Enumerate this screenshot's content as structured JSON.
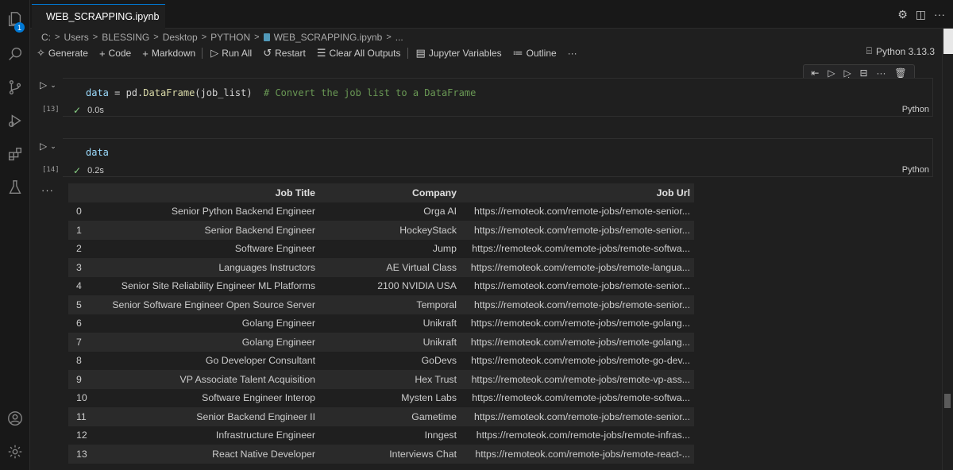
{
  "tab": {
    "title": "WEB_SCRAPPING.ipynb"
  },
  "activity": {
    "badge_count": "1"
  },
  "breadcrumb": {
    "items": [
      "C:",
      "Users",
      "BLESSING",
      "Desktop",
      "PYTHON",
      "WEB_SCRAPPING.ipynb",
      "..."
    ]
  },
  "toolbar": {
    "generate": "Generate",
    "code": "Code",
    "markdown": "Markdown",
    "run_all": "Run All",
    "restart": "Restart",
    "clear_outputs": "Clear All Outputs",
    "jupyter_variables": "Jupyter Variables",
    "outline": "Outline",
    "more": "···"
  },
  "kernel": {
    "label": "Python 3.13.3"
  },
  "cells": [
    {
      "exec": "[13]",
      "code_var": "data",
      "code_op": " = pd.",
      "code_fn": "DataFrame",
      "code_args": "(job_list)",
      "code_comment": "  # Convert the job list to a DataFrame",
      "time": "0.0s",
      "lang": "Python"
    },
    {
      "exec": "[14]",
      "code_var": "data",
      "time": "0.2s",
      "lang": "Python"
    }
  ],
  "output": {
    "more": "···",
    "columns": [
      "",
      "Job Title",
      "Company",
      "Job Url"
    ],
    "rows": [
      [
        "0",
        "Senior Python Backend Engineer",
        "Orga AI",
        "https://remoteok.com/remote-jobs/remote-senior..."
      ],
      [
        "1",
        "Senior Backend Engineer",
        "HockeyStack",
        "https://remoteok.com/remote-jobs/remote-senior..."
      ],
      [
        "2",
        "Software Engineer",
        "Jump",
        "https://remoteok.com/remote-jobs/remote-softwa..."
      ],
      [
        "3",
        "Languages Instructors",
        "AE Virtual Class",
        "https://remoteok.com/remote-jobs/remote-langua..."
      ],
      [
        "4",
        "Senior Site Reliability Engineer ML Platforms",
        "2100 NVIDIA USA",
        "https://remoteok.com/remote-jobs/remote-senior..."
      ],
      [
        "5",
        "Senior Software Engineer Open Source Server",
        "Temporal",
        "https://remoteok.com/remote-jobs/remote-senior..."
      ],
      [
        "6",
        "Golang Engineer",
        "Unikraft",
        "https://remoteok.com/remote-jobs/remote-golang..."
      ],
      [
        "7",
        "Golang Engineer",
        "Unikraft",
        "https://remoteok.com/remote-jobs/remote-golang..."
      ],
      [
        "8",
        "Go Developer Consultant",
        "GoDevs",
        "https://remoteok.com/remote-jobs/remote-go-dev..."
      ],
      [
        "9",
        "VP Associate Talent Acquisition",
        "Hex Trust",
        "https://remoteok.com/remote-jobs/remote-vp-ass..."
      ],
      [
        "10",
        "Software Engineer Interop",
        "Mysten Labs",
        "https://remoteok.com/remote-jobs/remote-softwa..."
      ],
      [
        "11",
        "Senior Backend Engineer II",
        "Gametime",
        "https://remoteok.com/remote-jobs/remote-senior..."
      ],
      [
        "12",
        "Infrastructure Engineer",
        "Inngest",
        "https://remoteok.com/remote-jobs/remote-infras..."
      ],
      [
        "13",
        "React Native Developer",
        "Interviews Chat",
        "https://remoteok.com/remote-jobs/remote-react-..."
      ]
    ]
  }
}
